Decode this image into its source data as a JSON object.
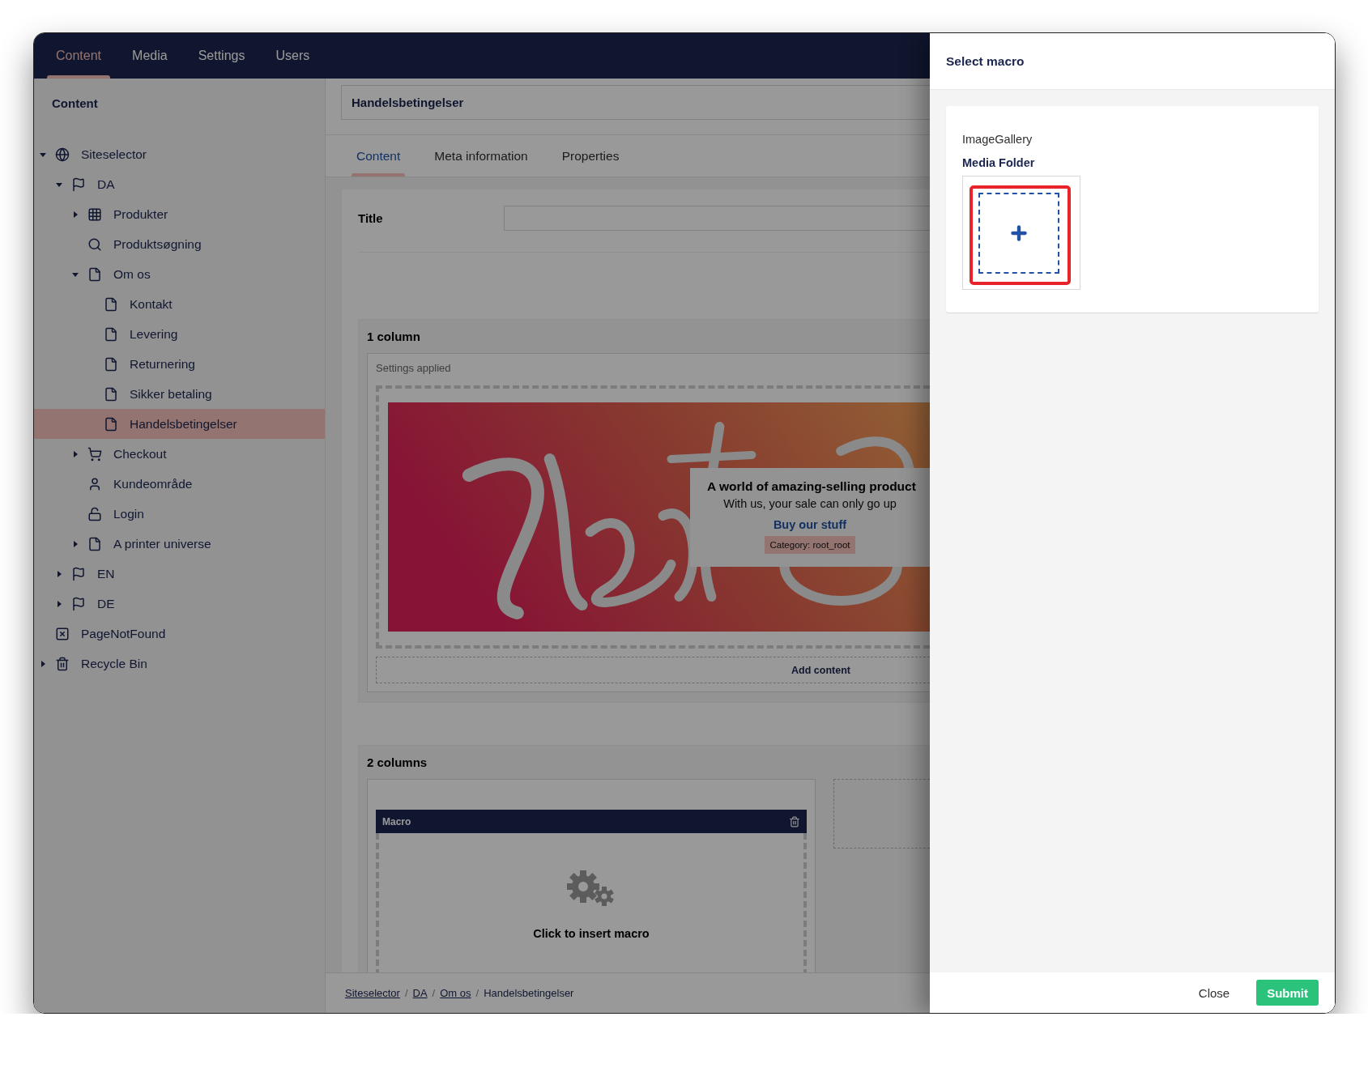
{
  "top_nav": [
    {
      "label": "Content",
      "selected": true
    },
    {
      "label": "Media",
      "selected": false
    },
    {
      "label": "Settings",
      "selected": false
    },
    {
      "label": "Users",
      "selected": false
    }
  ],
  "sidebar": {
    "title": "Content",
    "tree": [
      {
        "label": "Siteselector",
        "kind": "site",
        "expanded": true,
        "selected": false,
        "children": [
          {
            "label": "DA",
            "kind": "language",
            "expanded": true,
            "selected": false,
            "children": [
              {
                "label": "Produkter",
                "kind": "listing",
                "expanded": false,
                "selected": false
              },
              {
                "label": "Produktsøgning",
                "kind": "search",
                "selected": false
              },
              {
                "label": "Om os",
                "kind": "page",
                "expanded": true,
                "selected": false,
                "children": [
                  {
                    "label": "Kontakt",
                    "kind": "page",
                    "selected": false
                  },
                  {
                    "label": "Levering",
                    "kind": "page",
                    "selected": false
                  },
                  {
                    "label": "Returnering",
                    "kind": "page",
                    "selected": false
                  },
                  {
                    "label": "Sikker betaling",
                    "kind": "page",
                    "selected": false
                  },
                  {
                    "label": "Handelsbetingelser",
                    "kind": "page",
                    "selected": true
                  }
                ]
              },
              {
                "label": "Checkout",
                "kind": "cart",
                "expanded": false,
                "selected": false
              },
              {
                "label": "Kundeområde",
                "kind": "member",
                "selected": false
              },
              {
                "label": "Login",
                "kind": "login",
                "selected": false
              },
              {
                "label": "A printer universe",
                "kind": "page",
                "expanded": false,
                "selected": false
              }
            ]
          },
          {
            "label": "EN",
            "kind": "language",
            "expanded": false,
            "selected": false
          },
          {
            "label": "DE",
            "kind": "language",
            "expanded": false,
            "selected": false
          }
        ]
      },
      {
        "label": "PageNotFound",
        "kind": "notfound",
        "selected": false
      },
      {
        "label": "Recycle Bin",
        "kind": "bin",
        "expanded": false,
        "selected": false
      }
    ]
  },
  "editor": {
    "name_value": "Handelsbetingelser",
    "tabs": [
      {
        "label": "Content",
        "selected": true
      },
      {
        "label": "Meta information",
        "selected": false
      },
      {
        "label": "Properties",
        "selected": false
      }
    ],
    "title_label": "Title",
    "one_column": {
      "title": "1 column",
      "settings_note": "Settings applied",
      "banner": {
        "kind": "picture",
        "heading": "A world of amazing-selling product",
        "subheading": "With us, your sale can only go up",
        "link": "Buy our stuff",
        "category": "Category: root_root"
      },
      "add_content": "Add content"
    },
    "two_columns": {
      "title": "2 columns",
      "macro": {
        "title": "Macro",
        "prompt": "Click to insert macro"
      }
    }
  },
  "breadcrumb": {
    "separator": "/",
    "items": [
      {
        "label": "Siteselector",
        "link": true
      },
      {
        "label": "DA",
        "link": true
      },
      {
        "label": "Om os",
        "link": true
      },
      {
        "label": "Handelsbetingelser",
        "link": false
      }
    ]
  },
  "dialog": {
    "title": "Select macro",
    "macro_name": "ImageGallery",
    "field_label": "Media Folder",
    "buttons": [
      {
        "label": "Close",
        "kind": "link"
      },
      {
        "label": "Submit",
        "kind": "primary"
      }
    ]
  }
}
